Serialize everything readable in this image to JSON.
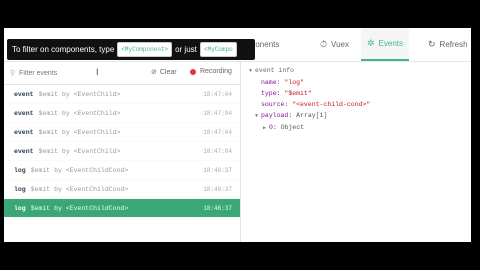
{
  "tabs": [
    {
      "label": "Components",
      "icon": "components-icon"
    },
    {
      "label": "Vuex",
      "icon": "vuex-icon"
    },
    {
      "label": "Events",
      "icon": "events-icon"
    },
    {
      "label": "Refresh",
      "icon": "refresh-icon"
    }
  ],
  "tooltip": {
    "text1": "To filter on components, type",
    "code1": "<MyComponent>",
    "text2": "or just",
    "code2": "<MyCompo"
  },
  "toolbar": {
    "filter_placeholder": "Filter events",
    "clear_label": "Clear",
    "recording_label": "Recording"
  },
  "events": [
    {
      "type": "event",
      "desc": "$emit by <EventChild>",
      "time": "18:47:04"
    },
    {
      "type": "event",
      "desc": "$emit by <EventChild>",
      "time": "18:47:04"
    },
    {
      "type": "event",
      "desc": "$emit by <EventChild>",
      "time": "18:47:04"
    },
    {
      "type": "event",
      "desc": "$emit by <EventChild>",
      "time": "18:47:04"
    },
    {
      "type": "log",
      "desc": "$emit by <EventChildCond>",
      "time": "18:46:37"
    },
    {
      "type": "log",
      "desc": "$emit by <EventChildCond>",
      "time": "18:46:37"
    },
    {
      "type": "log",
      "desc": "$emit by <EventChildCond>",
      "time": "18:46:37"
    }
  ],
  "selected_index": 6,
  "details": {
    "header": "event info",
    "name_key": "name:",
    "name_val": "\"log\"",
    "type_key": "type:",
    "type_val": "\"$emit\"",
    "source_key": "source:",
    "source_val": "\"<event-child-cond>\"",
    "payload_key": "payload:",
    "payload_val": "Array[1]",
    "item_key": "0:",
    "item_val": "Object"
  },
  "colors": {
    "accent": "#42b983",
    "selected_row": "#3ba776",
    "record": "#e5323b"
  }
}
